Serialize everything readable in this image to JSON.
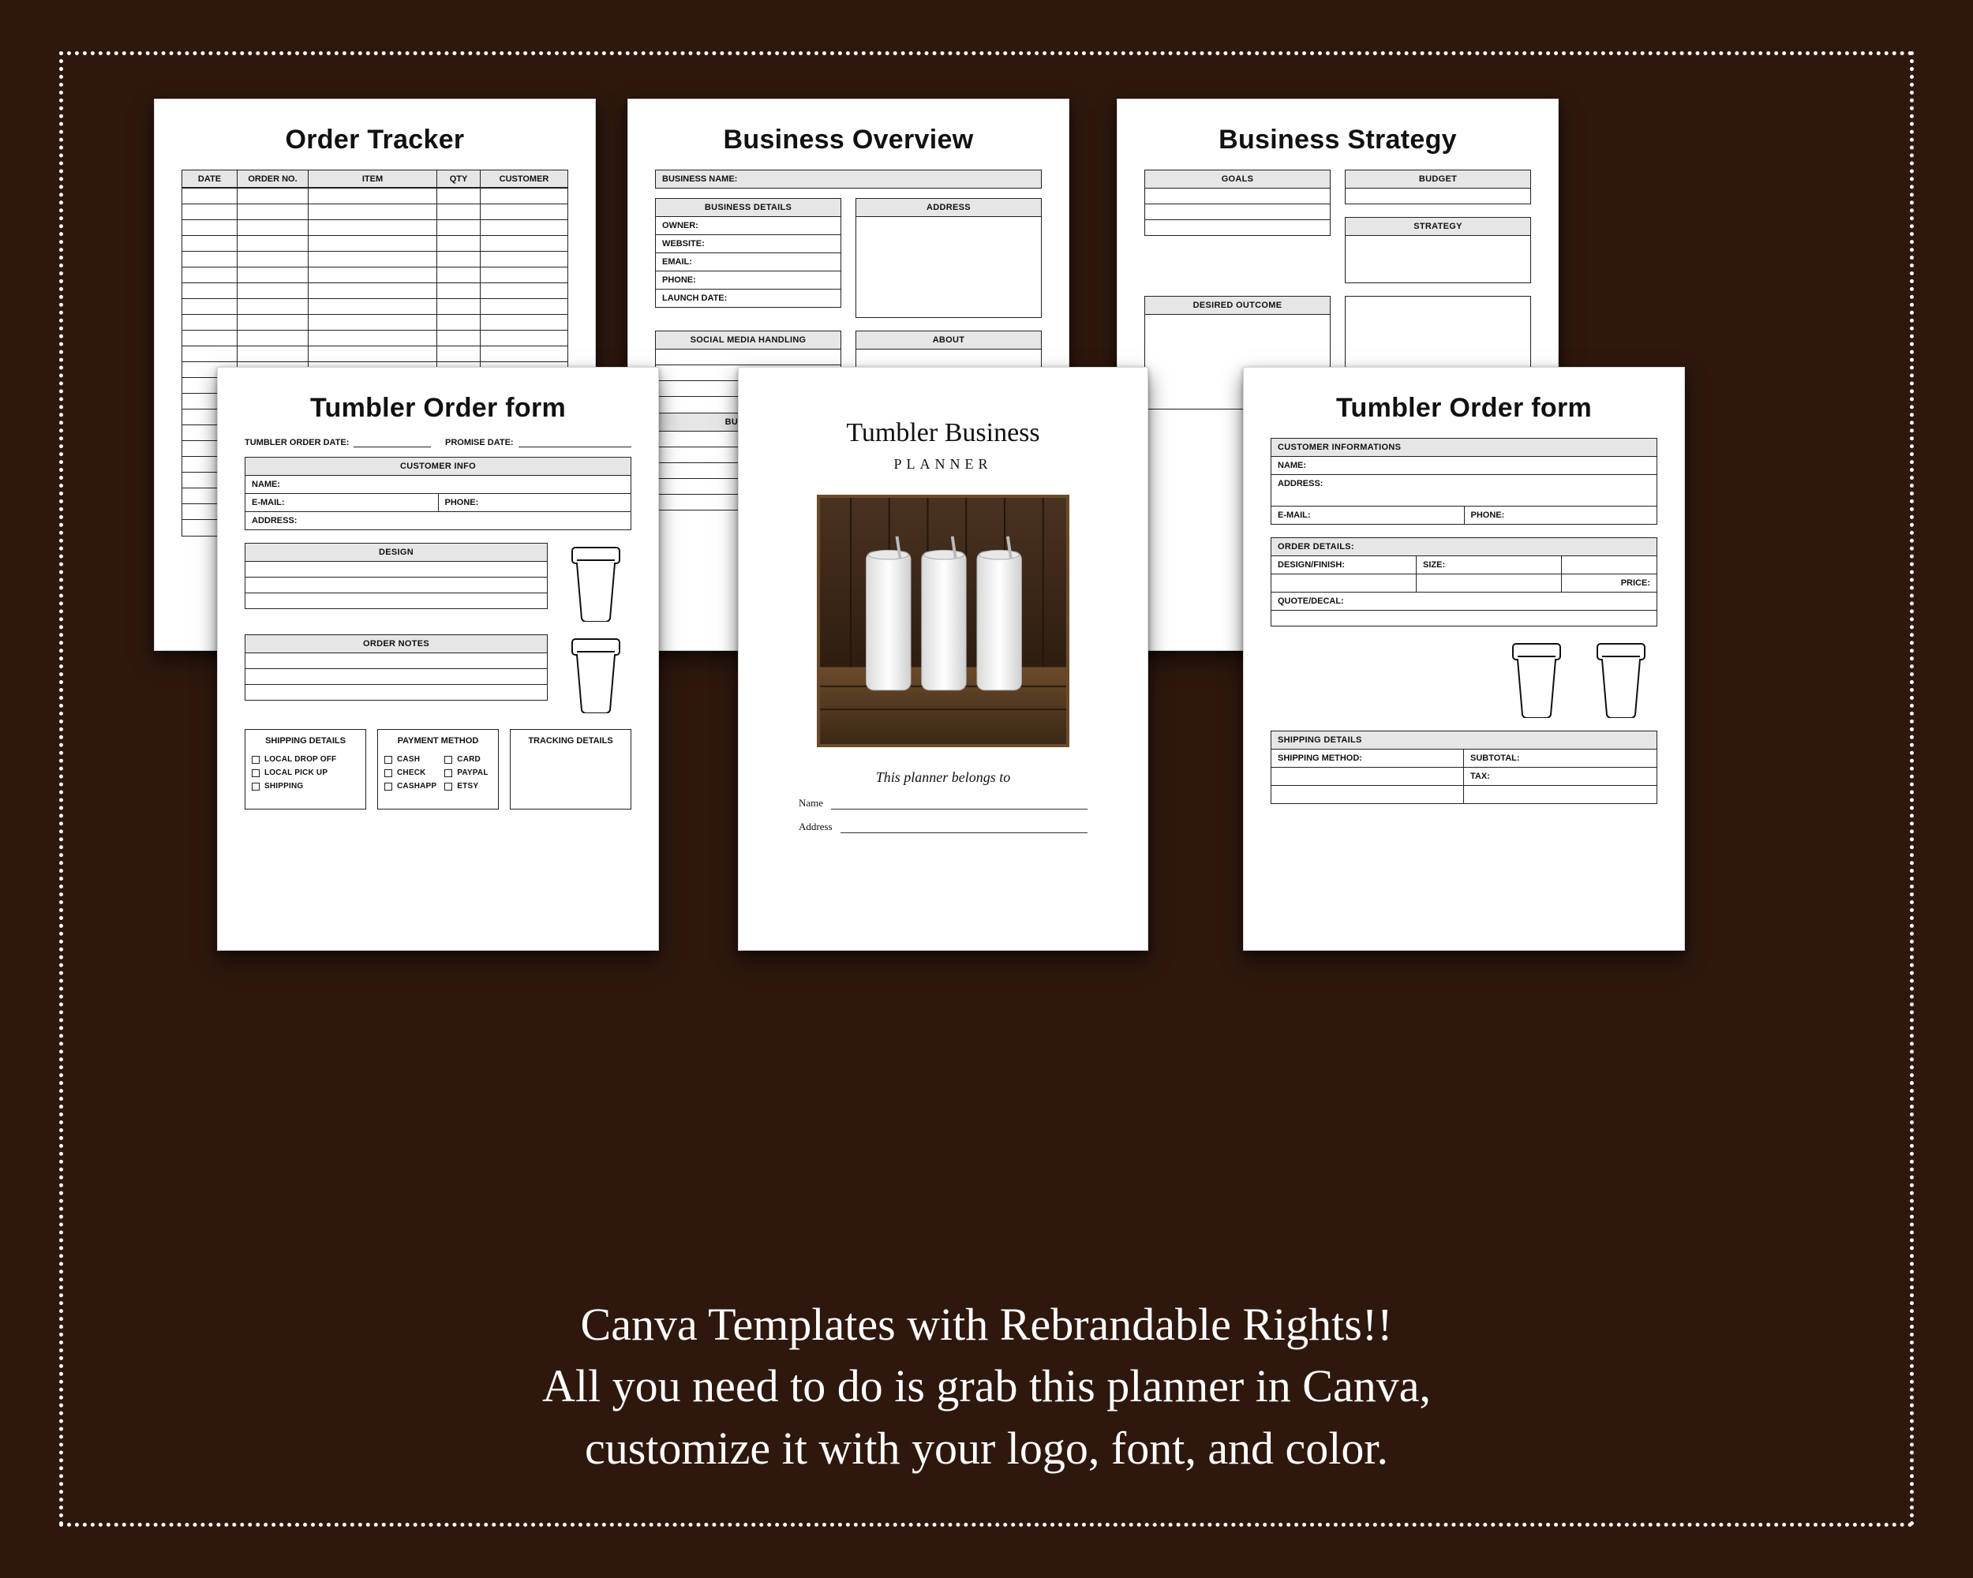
{
  "caption": {
    "line1": "Canva Templates with Rebrandable Rights!!",
    "line2": "All you need to do is grab this planner in Canva,",
    "line3": "customize it with your logo, font, and color."
  },
  "colors": {
    "background": "#2e180e",
    "text": "#ffffff",
    "page": "#ffffff",
    "line": "#222222",
    "grey": "#e6e6e6"
  },
  "order_tracker": {
    "title": "Order Tracker",
    "columns": [
      "DATE",
      "ORDER NO.",
      "ITEM",
      "QTY",
      "CUSTOMER"
    ],
    "blank_rows": 22
  },
  "business_overview": {
    "title": "Business Overview",
    "business_name_label": "BUSINESS NAME:",
    "details_header": "BUSINESS DETAILS",
    "address_header": "ADDRESS",
    "detail_fields": [
      "OWNER:",
      "WEBSITE:",
      "EMAIL:",
      "PHONE:",
      "LAUNCH DATE:"
    ],
    "social_header": "SOCIAL MEDIA HANDLING",
    "about_header": "ABOUT",
    "business_section_label": "BUSINESS"
  },
  "business_strategy": {
    "title": "Business Strategy",
    "goals_header": "GOALS",
    "budget_header": "BUDGET",
    "strategy_header": "STRATEGY",
    "desired_outcome_header": "DESIRED OUTCOME"
  },
  "order_form_variant_a": {
    "title": "Tumbler Order form",
    "date_label": "TUMBLER ORDER DATE:",
    "promise_label": "PROMISE DATE:",
    "customer_info_header": "CUSTOMER INFO",
    "name_label": "NAME:",
    "email_label": "E-MAIL:",
    "phone_label": "PHONE:",
    "address_label": "ADDRESS:",
    "design_header": "DESIGN",
    "order_notes_header": "ORDER NOTES",
    "shipping_details_header": "SHIPPING DETAILS",
    "payment_method_header": "PAYMENT METHOD",
    "tracking_details_header": "TRACKING DETAILS",
    "shipping_options": [
      "LOCAL DROP OFF",
      "LOCAL PICK UP",
      "SHIPPING"
    ],
    "payment_options_left": [
      "CASH",
      "CHECK",
      "CASHAPP"
    ],
    "payment_options_right": [
      "CARD",
      "PAYPAL",
      "ETSY"
    ]
  },
  "cover": {
    "title": "Tumbler Business",
    "subtitle": "PLANNER",
    "belongs": "This planner belongs to",
    "name_label": "Name",
    "address_label": "Address"
  },
  "order_form_variant_b": {
    "title": "Tumbler Order form",
    "customer_informations_header": "CUSTOMER INFORMATIONS",
    "name_label": "NAME:",
    "address_label": "ADDRESS:",
    "email_label": "E-MAIL:",
    "phone_label": "PHONE:",
    "order_details_header": "ORDER DETAILS:",
    "design_finish_label": "DESIGN/FINISH:",
    "size_label": "SIZE:",
    "price_label": "PRICE:",
    "quote_decal_label": "QUOTE/DECAL:",
    "shipping_details_header": "SHIPPING DETAILS",
    "shipping_method_label": "SHIPPING METHOD:",
    "subtotal_label": "SUBTOTAL:",
    "tax_label": "TAX:"
  }
}
